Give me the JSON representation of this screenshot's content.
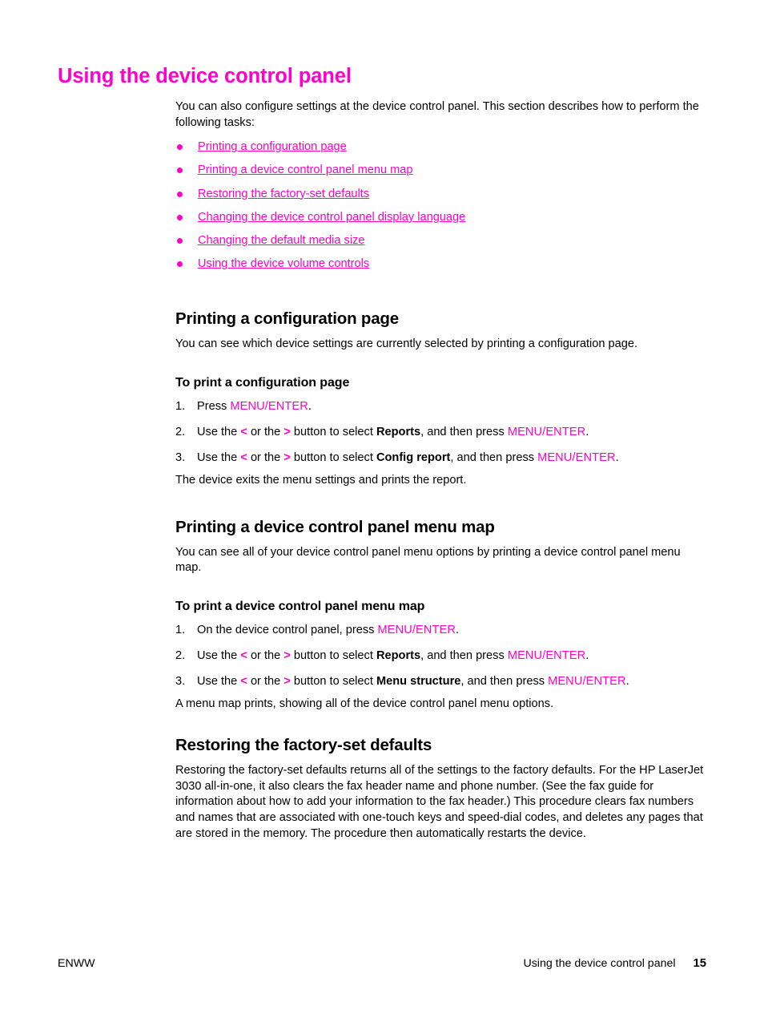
{
  "page": {
    "chapter_title": "Using the device control panel",
    "intro_paragraph": "You can also configure settings at the device control panel. This section describes how to perform the following tasks:"
  },
  "link_list": [
    {
      "label": "Printing a configuration page"
    },
    {
      "label": "Printing a device control panel menu map"
    },
    {
      "label": "Restoring the factory-set defaults"
    },
    {
      "label": "Changing the device control panel display language"
    },
    {
      "label": "Changing the default media size"
    },
    {
      "label": "Using the device volume controls"
    }
  ],
  "sections": {
    "config_page": {
      "heading": "Printing a configuration page",
      "intro": "You can see which device settings are currently selected by printing a configuration page.",
      "sub_heading": "To print a configuration page",
      "steps": [
        {
          "number": "1.",
          "pre": "Press ",
          "key1": "MENU/ENTER",
          "post": "."
        },
        {
          "number": "2.",
          "pre": "Use the ",
          "arrow_left": "<",
          "mid1": " or the ",
          "arrow_right": ">",
          "mid2": " button to select ",
          "bold": "Reports",
          "mid3": ", and then press ",
          "key1": "MENU/ENTER",
          "post": "."
        },
        {
          "number": "3.",
          "pre": "Use the ",
          "arrow_left": "<",
          "mid1": " or the ",
          "arrow_right": ">",
          "mid2": " button to select ",
          "bold": "Config report",
          "mid3": ", and then press ",
          "key1": "MENU/ENTER",
          "post": "."
        }
      ],
      "tail": "The device exits the menu settings and prints the report."
    },
    "menu_map": {
      "heading": "Printing a device control panel menu map",
      "intro": "You can see all of your device control panel menu options by printing a device control panel menu map.",
      "sub_heading": "To print a device control panel menu map",
      "steps": [
        {
          "number": "1.",
          "pre": "On the device control panel, press ",
          "key1": "MENU/ENTER",
          "post": "."
        },
        {
          "number": "2.",
          "pre": "Use the ",
          "arrow_left": "<",
          "mid1": " or the ",
          "arrow_right": ">",
          "mid2": " button to select ",
          "bold": "Reports",
          "mid3": ", and then press ",
          "key1": "MENU/ENTER",
          "post": "."
        },
        {
          "number": "3.",
          "pre": "Use the ",
          "arrow_left": "<",
          "mid1": " or the ",
          "arrow_right": ">",
          "mid2": " button to select ",
          "bold": "Menu structure",
          "mid3": ", and then press ",
          "key1": "MENU/ENTER",
          "post": "."
        }
      ],
      "tail": "A menu map prints, showing all of the device control panel menu options."
    },
    "factory_defaults": {
      "heading": "Restoring the factory-set defaults",
      "body": "Restoring the factory-set defaults returns all of the settings to the factory defaults. For the HP LaserJet 3030 all-in-one, it also clears the fax header name and phone number. (See the fax guide for information about how to add your information to the fax header.) This procedure clears fax numbers and names that are associated with one-touch keys and speed-dial codes, and deletes any pages that are stored in the memory. The procedure then automatically restarts the device."
    }
  },
  "footer": {
    "left": "ENWW",
    "running_head": "Using the device control panel",
    "page_number": "15"
  },
  "colors": {
    "accent": "#ff00cc",
    "text": "#000000",
    "background": "#ffffff"
  }
}
